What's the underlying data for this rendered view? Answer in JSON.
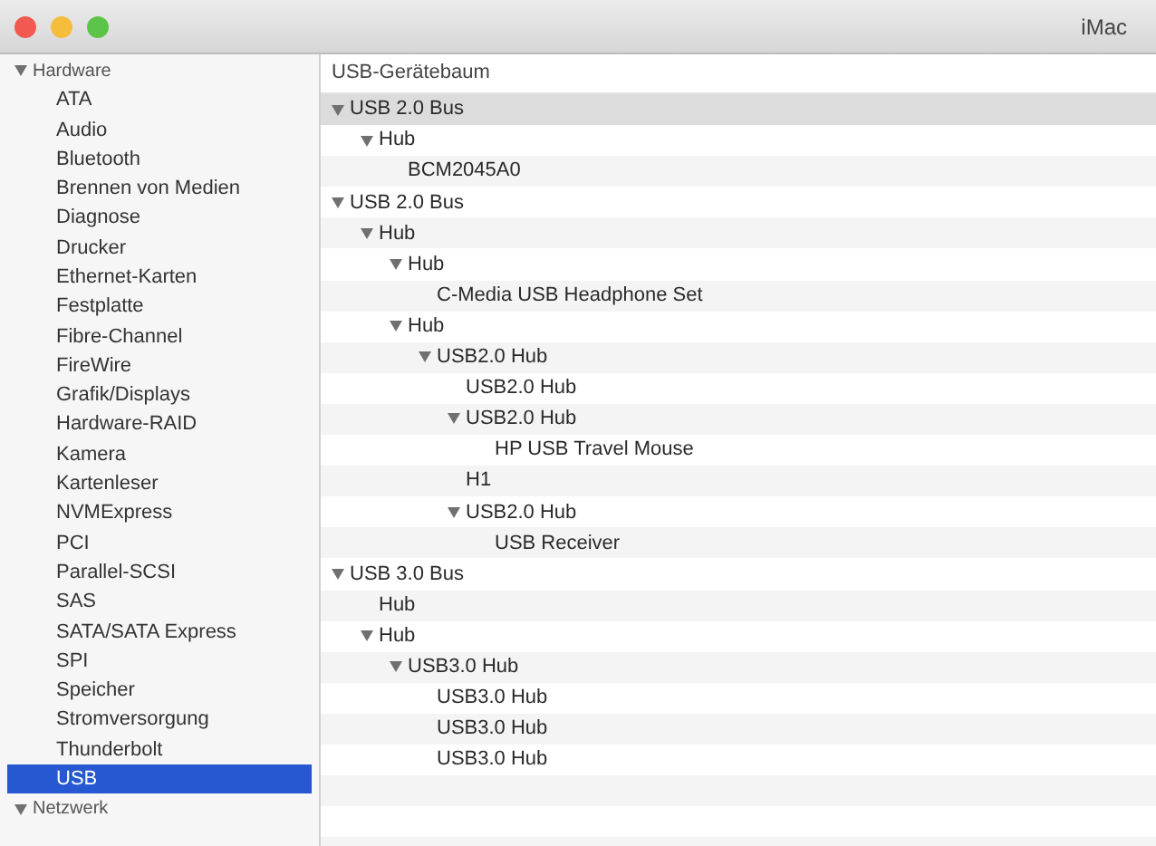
{
  "window": {
    "title": "iMac"
  },
  "sidebar": {
    "groups": [
      {
        "label": "Hardware",
        "expanded": true,
        "items": [
          {
            "label": "ATA",
            "selected": false
          },
          {
            "label": "Audio",
            "selected": false
          },
          {
            "label": "Bluetooth",
            "selected": false
          },
          {
            "label": "Brennen von Medien",
            "selected": false
          },
          {
            "label": "Diagnose",
            "selected": false
          },
          {
            "label": "Drucker",
            "selected": false
          },
          {
            "label": "Ethernet-Karten",
            "selected": false
          },
          {
            "label": "Festplatte",
            "selected": false
          },
          {
            "label": "Fibre-Channel",
            "selected": false
          },
          {
            "label": "FireWire",
            "selected": false
          },
          {
            "label": "Grafik/Displays",
            "selected": false
          },
          {
            "label": "Hardware-RAID",
            "selected": false
          },
          {
            "label": "Kamera",
            "selected": false
          },
          {
            "label": "Kartenleser",
            "selected": false
          },
          {
            "label": "NVMExpress",
            "selected": false
          },
          {
            "label": "PCI",
            "selected": false
          },
          {
            "label": "Parallel-SCSI",
            "selected": false
          },
          {
            "label": "SAS",
            "selected": false
          },
          {
            "label": "SATA/SATA Express",
            "selected": false
          },
          {
            "label": "SPI",
            "selected": false
          },
          {
            "label": "Speicher",
            "selected": false
          },
          {
            "label": "Stromversorgung",
            "selected": false
          },
          {
            "label": "Thunderbolt",
            "selected": false
          },
          {
            "label": "USB",
            "selected": true
          }
        ]
      },
      {
        "label": "Netzwerk",
        "expanded": true
      }
    ]
  },
  "tree": {
    "heading": "USB-Gerätebaum",
    "items": [
      {
        "label": "USB 2.0 Bus",
        "selected": true,
        "expanded": true,
        "children": [
          {
            "label": "Hub",
            "selected": false,
            "expanded": true,
            "children": [
              {
                "label": "BCM2045A0",
                "selected": false
              }
            ]
          }
        ]
      },
      {
        "label": "USB 2.0 Bus",
        "selected": false,
        "expanded": true,
        "children": [
          {
            "label": "Hub",
            "selected": false,
            "expanded": true,
            "children": [
              {
                "label": "Hub",
                "selected": false,
                "expanded": true,
                "children": [
                  {
                    "label": "C-Media USB Headphone Set",
                    "selected": false
                  }
                ]
              },
              {
                "label": "Hub",
                "selected": false,
                "expanded": true,
                "children": [
                  {
                    "label": "USB2.0 Hub",
                    "selected": false,
                    "expanded": true,
                    "children": [
                      {
                        "label": "USB2.0 Hub",
                        "selected": false
                      },
                      {
                        "label": "USB2.0 Hub",
                        "selected": false,
                        "expanded": true,
                        "children": [
                          {
                            "label": "HP USB Travel Mouse",
                            "selected": false
                          }
                        ]
                      },
                      {
                        "label": "H1",
                        "selected": false
                      },
                      {
                        "label": "USB2.0 Hub",
                        "selected": false,
                        "expanded": true,
                        "children": [
                          {
                            "label": "USB Receiver",
                            "selected": false
                          }
                        ]
                      }
                    ]
                  }
                ]
              }
            ]
          }
        ]
      },
      {
        "label": "USB 3.0 Bus",
        "selected": false,
        "expanded": true,
        "children": [
          {
            "label": "Hub",
            "selected": false
          },
          {
            "label": "Hub",
            "selected": false,
            "expanded": true,
            "children": [
              {
                "label": "USB3.0 Hub",
                "selected": false,
                "expanded": true,
                "children": [
                  {
                    "label": "USB3.0 Hub",
                    "selected": false
                  },
                  {
                    "label": "USB3.0 Hub",
                    "selected": false
                  },
                  {
                    "label": "USB3.0 Hub",
                    "selected": false
                  }
                ]
              }
            ]
          }
        ]
      }
    ]
  }
}
